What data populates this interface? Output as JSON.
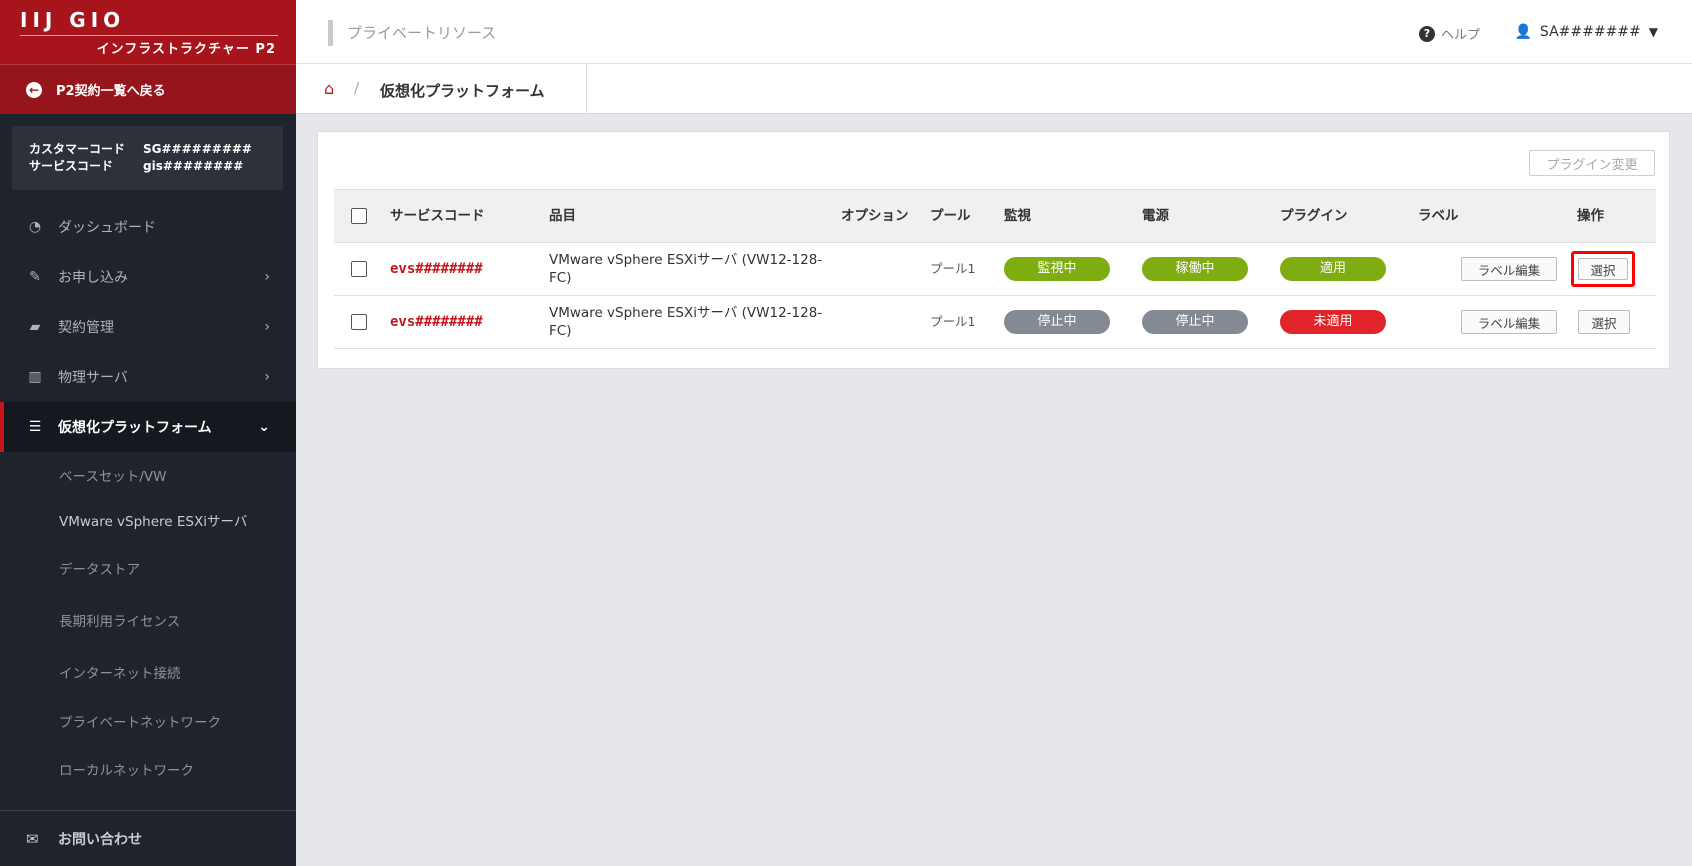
{
  "brand": {
    "logo": "IIJ GIO",
    "subtitle": "インフラストラクチャー P2"
  },
  "sidebar": {
    "back_label": "P2契約一覧へ戻る",
    "customer_code_label": "カスタマーコード",
    "customer_code_value": "SG#########",
    "service_code_label": "サービスコード",
    "service_code_value": "gis########",
    "items": [
      {
        "label": "ダッシュボード",
        "icon": "dashboard-icon",
        "chevron": ""
      },
      {
        "label": "お申し込み",
        "icon": "edit-icon",
        "chevron": "›"
      },
      {
        "label": "契約管理",
        "icon": "truck-icon",
        "chevron": "›"
      },
      {
        "label": "物理サーバ",
        "icon": "building-icon",
        "chevron": "›"
      },
      {
        "label": "仮想化プラットフォーム",
        "icon": "server-icon",
        "chevron": "⌄"
      }
    ],
    "subitems": [
      "ベースセット/VW",
      "VMware vSphere ESXiサーバ",
      "データストア",
      "長期利用ライセンス",
      "インターネット接続",
      "プライベートネットワーク",
      "ローカルネットワーク"
    ],
    "contact_label": "お問い合わせ"
  },
  "header": {
    "page_title": "プライベートリソース",
    "help_label": "ヘルプ",
    "user_label": "SA#######"
  },
  "breadcrumb": {
    "current": "仮想化プラットフォーム"
  },
  "panel": {
    "plugin_button": "プラグイン変更",
    "columns": [
      "サービスコード",
      "品目",
      "オプション",
      "プール",
      "監視",
      "電源",
      "プラグイン",
      "ラベル",
      "操作"
    ],
    "rows": [
      {
        "code": "evs########",
        "item": "VMware vSphere ESXiサーバ (VW12-128-FC)",
        "option": "",
        "pool": "プール1",
        "monitor": "監視中",
        "power": "稼働中",
        "plugin": "適用",
        "label_button": "ラベル編集",
        "action_button": "選択"
      },
      {
        "code": "evs########",
        "item": "VMware vSphere ESXiサーバ (VW12-128-FC)",
        "option": "",
        "pool": "プール1",
        "monitor": "停止中",
        "power": "停止中",
        "plugin": "未適用",
        "label_button": "ラベル編集",
        "action_button": "選択"
      }
    ]
  },
  "colors": {
    "brand_red": "#a8141c",
    "status_green": "#7fac10",
    "status_gray": "#838a93",
    "status_red": "#e0242a",
    "highlight": "#ff0000"
  }
}
